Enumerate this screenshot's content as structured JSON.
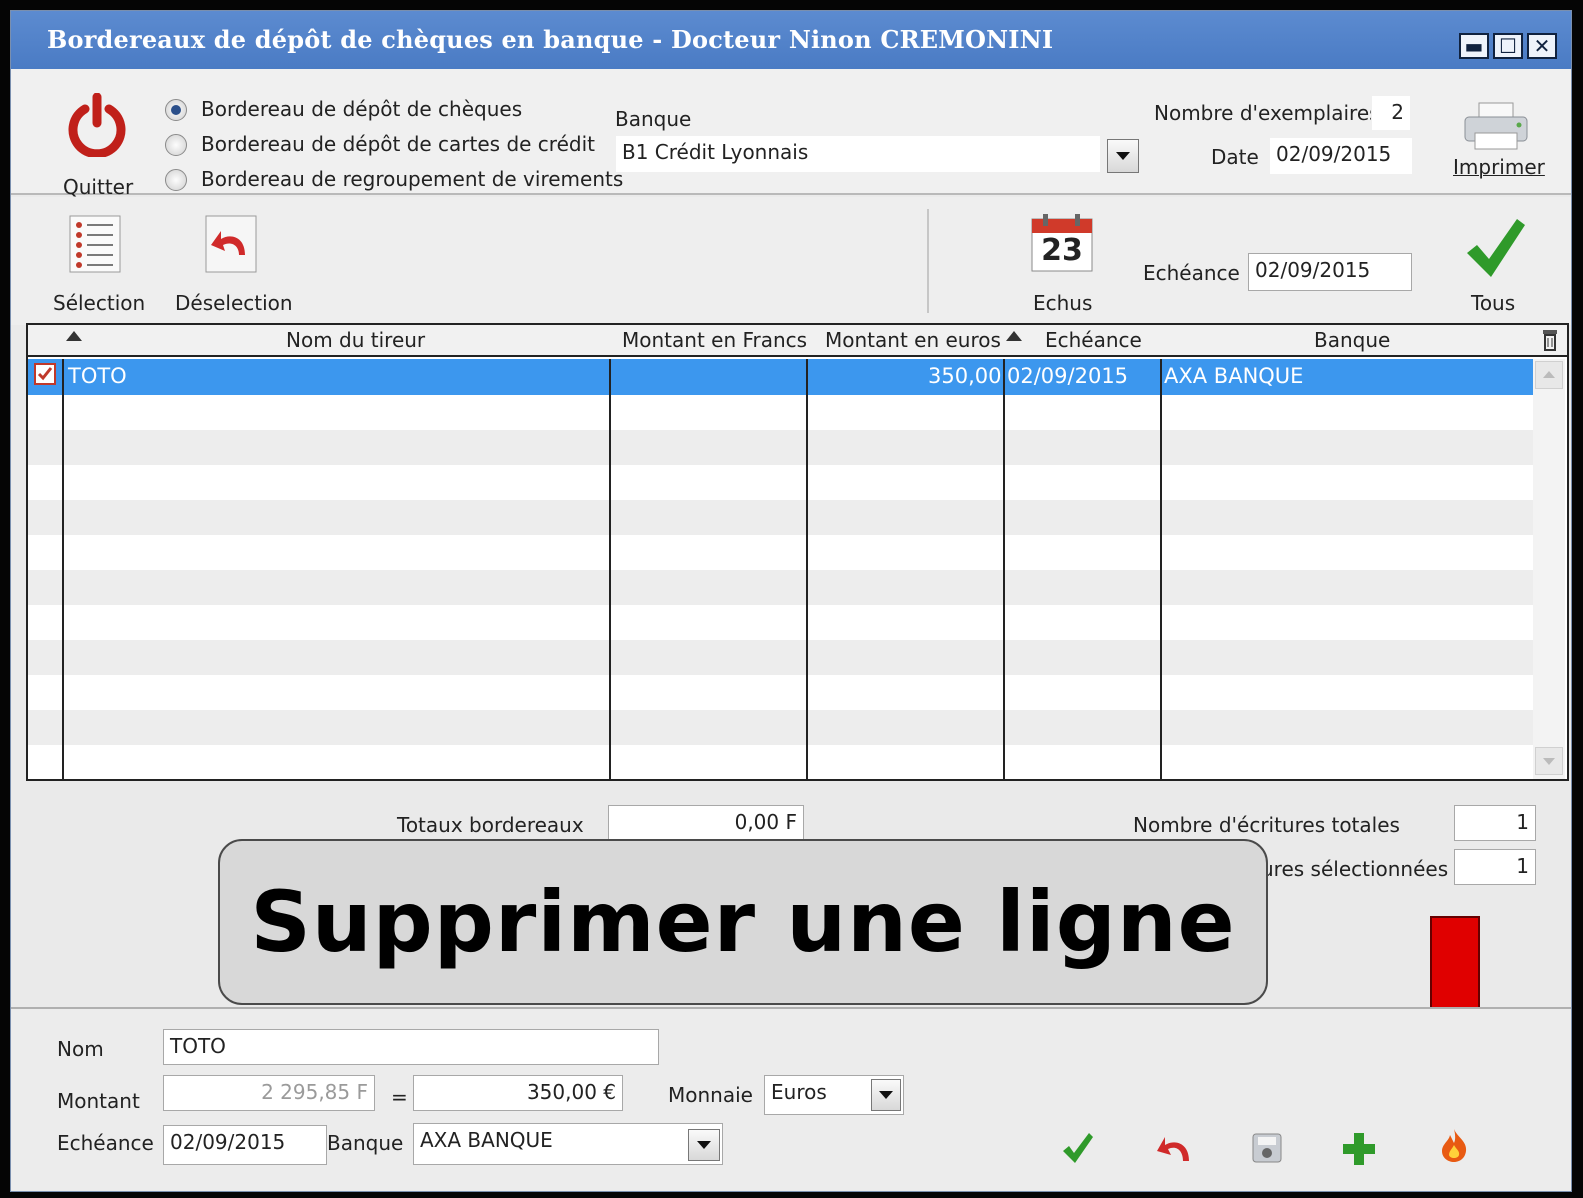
{
  "window": {
    "title": "Bordereaux de dépôt de chèques en banque - Docteur Ninon CREMONINI",
    "min_label": "▬",
    "max_label": "☐",
    "close_label": "✕"
  },
  "top": {
    "quit_label": "Quitter",
    "radios": [
      {
        "label": "Bordereau de dépôt de chèques",
        "checked": true
      },
      {
        "label": "Bordereau de dépôt de cartes de crédit",
        "checked": false
      },
      {
        "label": "Bordereau de regroupement de virements",
        "checked": false
      }
    ],
    "bank_label": "Banque",
    "bank_value": "B1 Crédit Lyonnais",
    "copies_label": "Nombre d'exemplaires:",
    "copies_value": "2",
    "date_label": "Date",
    "date_value": "02/09/2015",
    "print_label": "Imprimer"
  },
  "toolbar": {
    "selection_label": "Sélection",
    "deselection_label": "Déselection",
    "echus_label": "Echus",
    "calendar_day": "23",
    "echeance_label": "Echéance",
    "echeance_value": "02/09/2015",
    "tous_label": "Tous"
  },
  "grid": {
    "columns": [
      "Nom du tireur",
      "Montant en Francs",
      "Montant en euros",
      "Echéance",
      "Banque"
    ],
    "rows": [
      {
        "selected": true,
        "nom": "TOTO",
        "francs": "",
        "euros": "350,00",
        "echeance": "02/09/2015",
        "banque": "AXA BANQUE"
      }
    ]
  },
  "totals": {
    "totaux_label": "Totaux bordereaux",
    "totaux_value": "0,00 F",
    "nb_totales_label": "Nombre d'écritures totales",
    "nb_totales_value": "1",
    "nb_selected_label": "ures sélectionnées",
    "nb_selected_value": "1"
  },
  "overlay": {
    "text": "Supprimer une ligne"
  },
  "form": {
    "nom_label": "Nom",
    "nom_value": "TOTO",
    "montant_label": "Montant",
    "montant_francs": "2 295,85 F",
    "equals": "=",
    "montant_euros": "350,00 €",
    "monnaie_label": "Monnaie",
    "monnaie_value": "Euros",
    "echeance_label": "Echéance",
    "echeance_value": "02/09/2015",
    "banque_label": "Banque",
    "banque_value": "AXA BANQUE"
  },
  "colors": {
    "titlebar": "#4a7bc4",
    "selected_row": "#3c97ee",
    "stripe": "#ededed",
    "annotation_arrow": "#e00000",
    "quit_icon": "#c0201a",
    "check_icon": "#2f9a2a"
  },
  "icons": {
    "quit": "power-icon",
    "print": "printer-icon",
    "selection": "list-icon",
    "deselection": "undo-icon",
    "echus": "calendar-icon",
    "tous": "checkmark-icon",
    "delete": "flame-icon"
  }
}
